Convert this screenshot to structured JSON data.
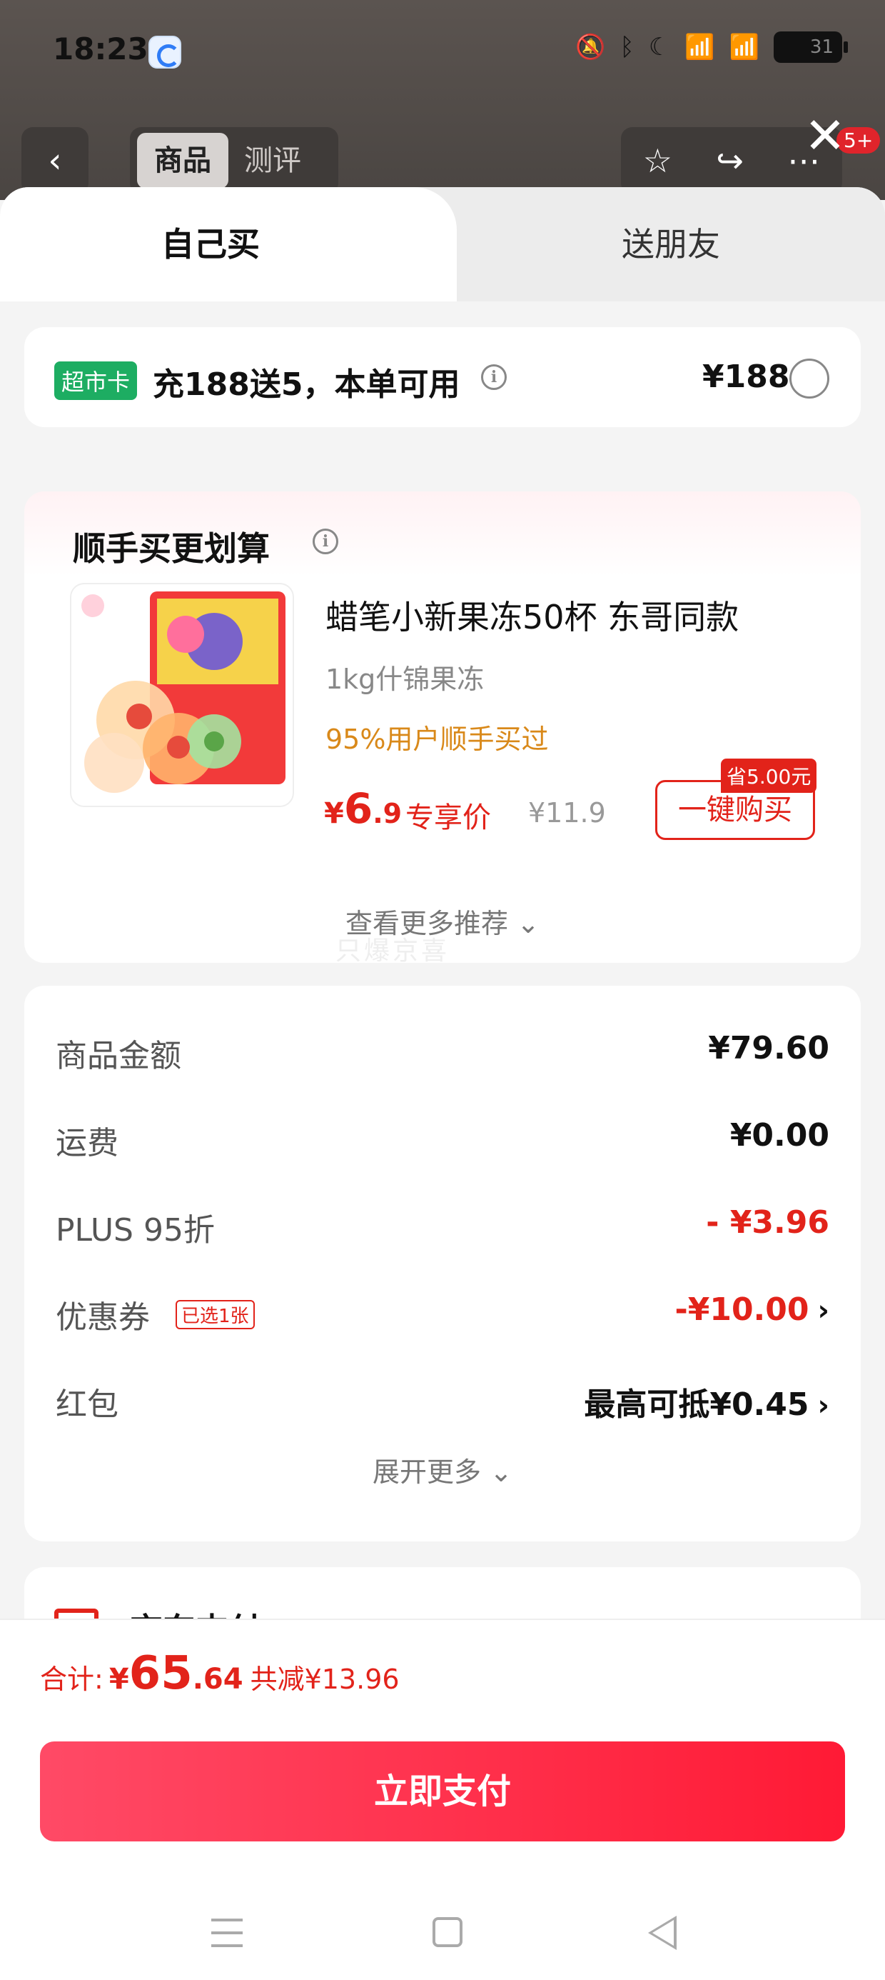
{
  "status_bar": {
    "time": "18:23",
    "icons": [
      "bell-off-icon",
      "bluetooth-icon",
      "moon-icon",
      "signal-5g-icon",
      "signal-5g-icon"
    ],
    "battery": "31"
  },
  "product_nav": {
    "tabs": [
      "商品",
      "测评"
    ],
    "badge": "5+"
  },
  "sheet_tabs": {
    "self": "自己买",
    "gift": "送朋友"
  },
  "supermarket": {
    "badge": "超市卡",
    "text": "充188送5，本单可用",
    "price": "¥188"
  },
  "recommend": {
    "title": "顺手买更划算",
    "product_name": "蜡笔小新果冻50杯 东哥同款",
    "spec": "1kg什锦果冻",
    "bought_pct": "95%用户顺手买过",
    "price_currency": "¥",
    "price_int": "6",
    "price_dec": ".9",
    "exclusive": "专享价",
    "orig_price": "¥11.9",
    "save": "省5.00元",
    "buy": "一键购买",
    "more": "查看更多推荐 ⌄"
  },
  "watermark": "只爆京喜",
  "summary": {
    "rows": [
      {
        "label": "商品金额",
        "value": "¥79.60"
      },
      {
        "label": "运费",
        "value": "¥0.00"
      },
      {
        "label": "PLUS 95折",
        "value": "- ¥3.96"
      },
      {
        "label": "优惠券",
        "tag": "已选1张",
        "value": "-¥10.00"
      },
      {
        "label": "红包",
        "value": "最高可抵¥0.45"
      }
    ],
    "more": "展开更多 ⌄"
  },
  "payment": {
    "label": "京东支付"
  },
  "footer": {
    "total_label": "合计:",
    "currency": "¥",
    "total_int": "65",
    "total_dec": ".64",
    "saved": "共减¥13.96",
    "pay_button": "立即支付"
  },
  "colors": {
    "accent_red": "#e2231a",
    "pay_gradient_start": "#ff4a66",
    "pay_gradient_end": "#ff1a35",
    "supermarket_green": "#1dad62"
  }
}
